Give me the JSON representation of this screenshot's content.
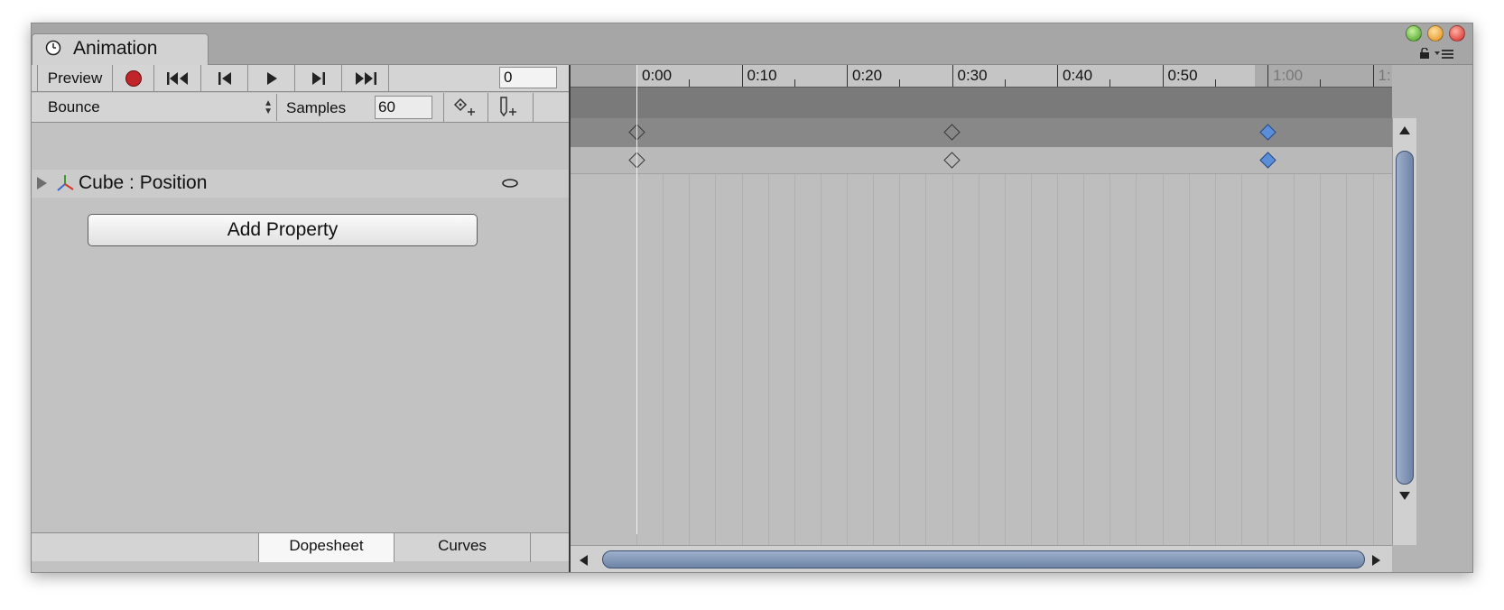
{
  "window": {
    "tab_title": "Animation"
  },
  "toolbar": {
    "preview_label": "Preview",
    "frame_value": "0"
  },
  "clip": {
    "name": "Bounce",
    "samples_label": "Samples",
    "samples_value": "60"
  },
  "hierarchy": {
    "property_label": "Cube : Position",
    "add_property_label": "Add Property"
  },
  "bottom_tabs": [
    {
      "label": "Dopesheet",
      "active": true
    },
    {
      "label": "Curves",
      "active": false
    }
  ],
  "timeline": {
    "ticks": [
      "0:00",
      "0:10",
      "0:20",
      "0:30",
      "0:40",
      "0:50",
      "1:00",
      "1:"
    ],
    "keyframes_summary": [
      {
        "frame": 0,
        "selected": false
      },
      {
        "frame": 30,
        "selected": false
      },
      {
        "frame": 60,
        "selected": true
      }
    ],
    "keyframes_track": [
      {
        "frame": 0,
        "selected": false
      },
      {
        "frame": 30,
        "selected": false
      },
      {
        "frame": 60,
        "selected": true
      }
    ]
  },
  "colors": {
    "record": "#c0252a",
    "selected_key": "#5a8ed8",
    "scroll_thumb": "#7e93b4"
  },
  "icons": [
    "clock-icon",
    "record-icon",
    "first-key-icon",
    "prev-key-icon",
    "play-icon",
    "next-key-icon",
    "last-key-icon",
    "add-keyframe-icon",
    "add-event-icon",
    "expand-triangle-icon",
    "transform-axis-icon",
    "visibility-icon",
    "lock-icon",
    "menu-icon"
  ]
}
